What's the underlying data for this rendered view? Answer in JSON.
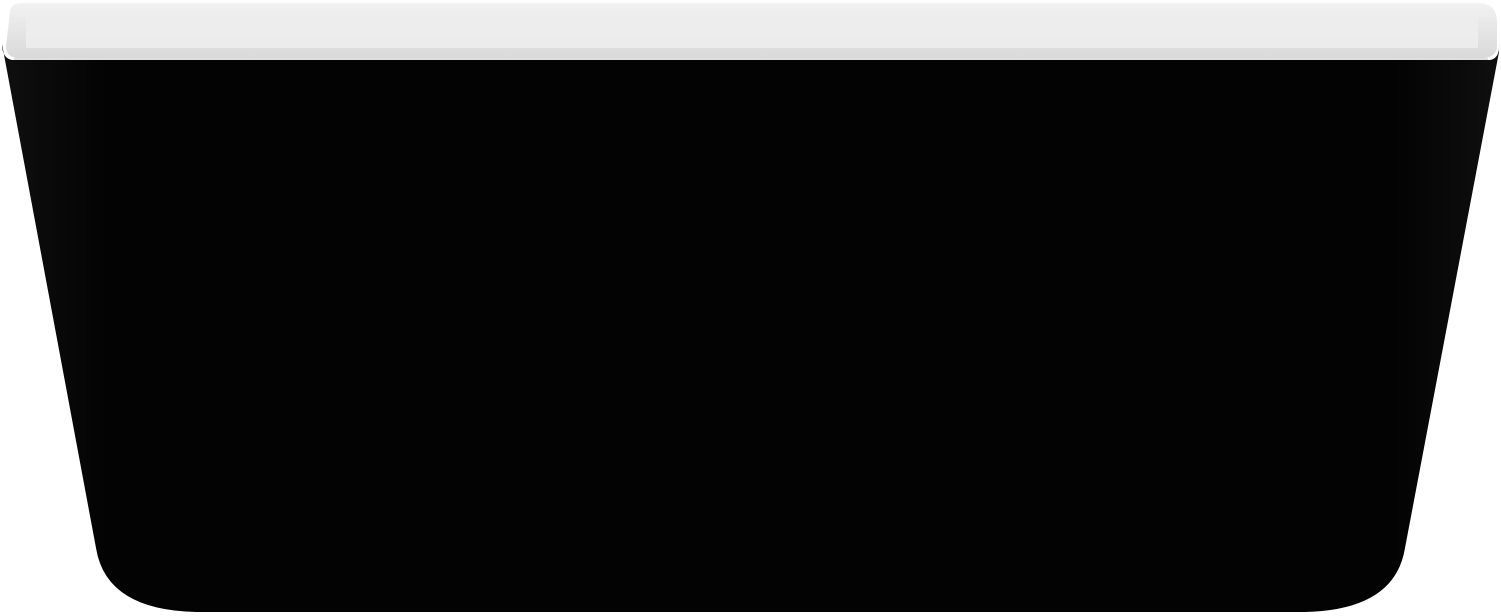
{
  "image": {
    "subject": "bathtub",
    "colors": {
      "background": "#ffffff",
      "body": "#050505",
      "rim": "#e6e6e6",
      "rim_inner": "#ffffff"
    }
  }
}
